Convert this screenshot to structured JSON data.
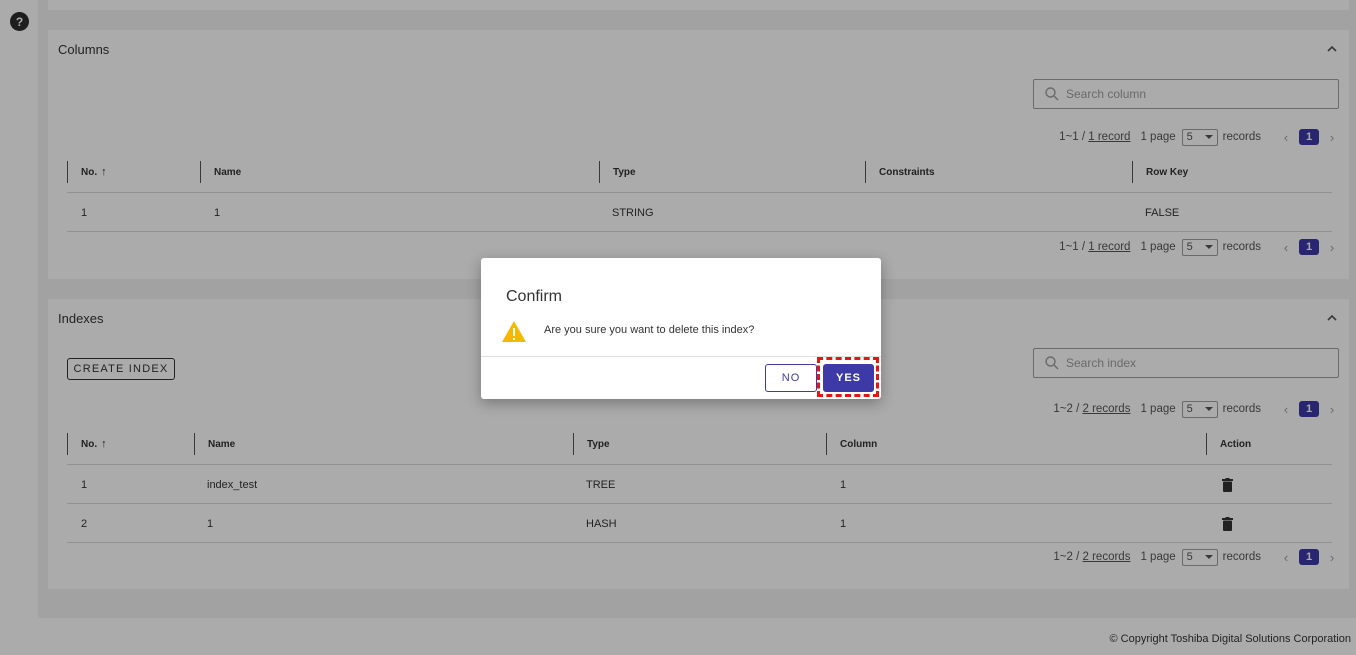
{
  "help": {
    "icon": "question-icon",
    "glyph": "?"
  },
  "columns": {
    "title": "Columns",
    "search_placeholder": "Search column",
    "pager": {
      "range": "1~1 / ",
      "records_link": "1 record",
      "pages": "1 page",
      "per_page": "5",
      "records_label": "records",
      "current_page": "1"
    },
    "headers": {
      "no": "No.",
      "name": "Name",
      "type": "Type",
      "constraints": "Constraints",
      "row_key": "Row Key"
    },
    "sort_arrow": "↑",
    "rows": [
      {
        "no": "1",
        "name": "1",
        "type": "STRING",
        "constraints": "",
        "row_key": "FALSE"
      }
    ]
  },
  "indexes": {
    "title": "Indexes",
    "create_label": "CREATE INDEX",
    "search_placeholder": "Search index",
    "pager": {
      "range": "1~2 / ",
      "records_link": "2 records",
      "pages": "1 page",
      "per_page": "5",
      "records_label": "records",
      "current_page": "1"
    },
    "headers": {
      "no": "No.",
      "name": "Name",
      "type": "Type",
      "column": "Column",
      "action": "Action"
    },
    "sort_arrow": "↑",
    "rows": [
      {
        "no": "1",
        "name": "index_test",
        "type": "TREE",
        "column": "1",
        "action_icon": "trash-icon"
      },
      {
        "no": "2",
        "name": "1",
        "type": "HASH",
        "column": "1",
        "action_icon": "trash-icon"
      }
    ]
  },
  "footer": {
    "copyright": "© Copyright Toshiba Digital Solutions Corporation"
  },
  "dialog": {
    "title": "Confirm",
    "message": "Are you sure you want to delete this index?",
    "no_label": "NO",
    "yes_label": "YES",
    "icon": "warning-icon"
  },
  "colors": {
    "primary": "#3d3aa8",
    "warning": "#f5b800",
    "highlight": "#e0161b",
    "overlay": "rgba(0,0,0,0.33)"
  }
}
